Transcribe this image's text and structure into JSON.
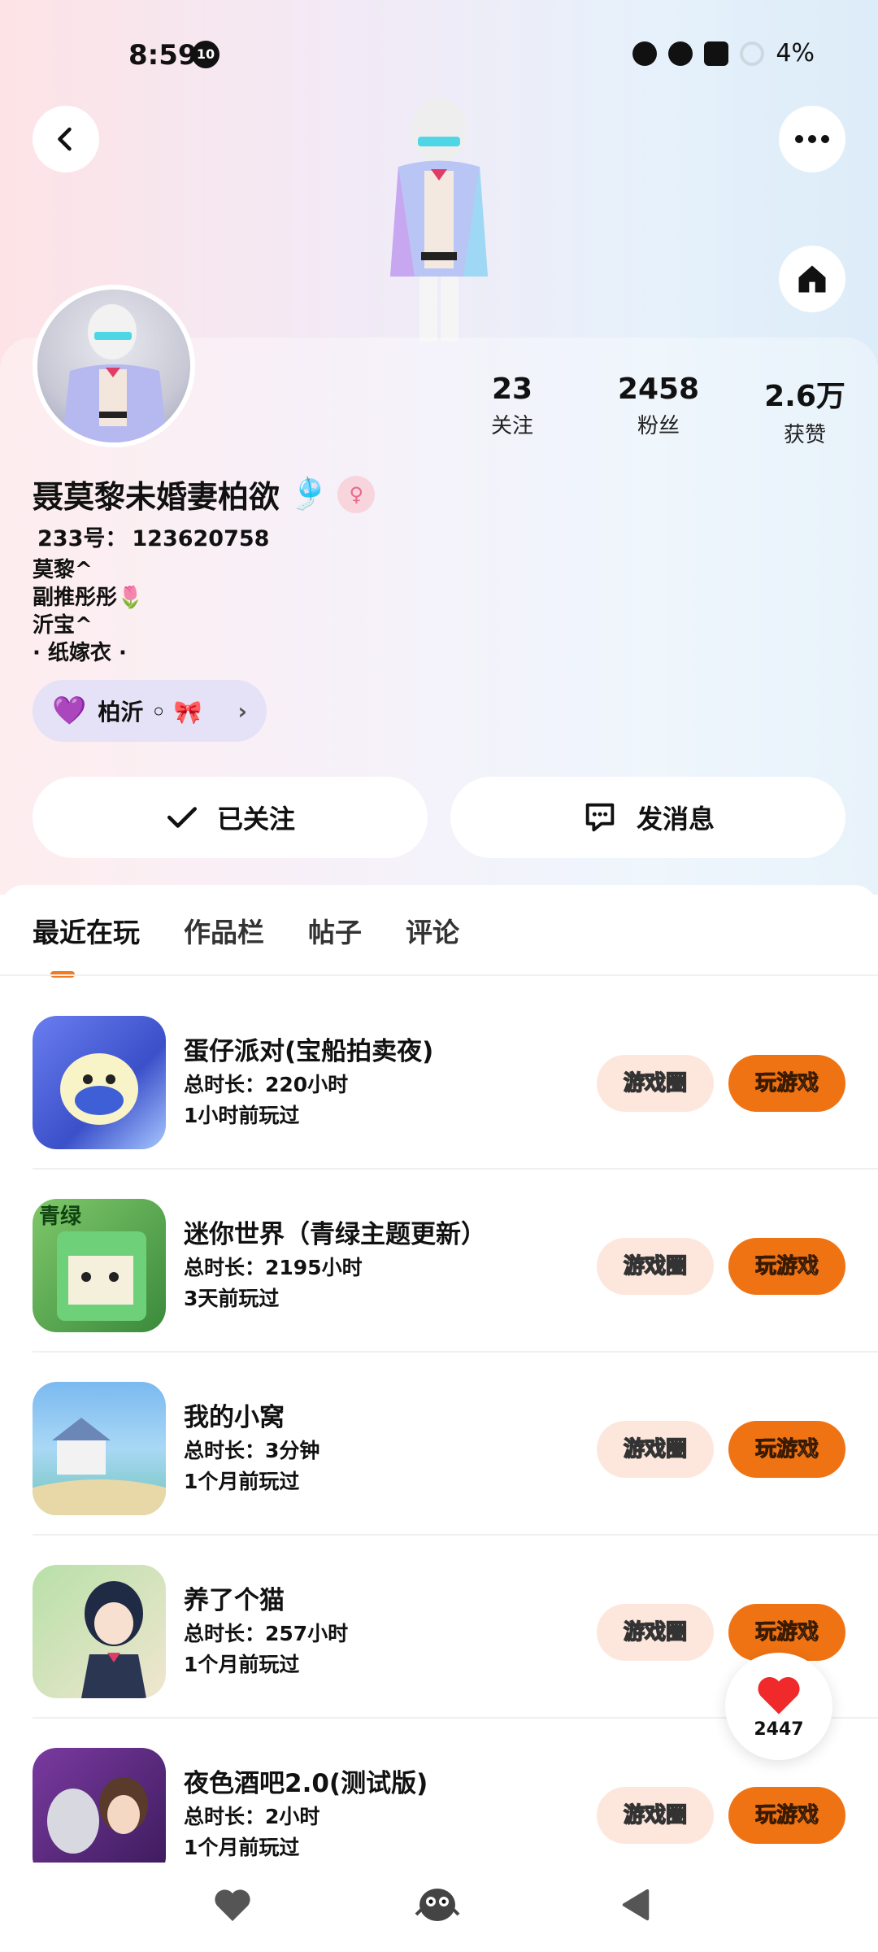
{
  "status": {
    "time": "8:59",
    "notification_badge": "10",
    "battery": "4%"
  },
  "header": {
    "back_icon": "chevron-left-icon",
    "more_icon": "ellipsis-icon",
    "home_icon": "home-icon"
  },
  "profile": {
    "stats": [
      {
        "value": "23",
        "label": "关注"
      },
      {
        "value": "2458",
        "label": "粉丝"
      },
      {
        "value": "2.6万",
        "label": "获赞"
      }
    ],
    "nickname": "聂莫黎未婚妻柏欲",
    "nickname_emoji": "🎐",
    "gender_symbol": "♀",
    "uid_label": "233号：",
    "uid_value": "123620758",
    "bio_lines": [
      "莫黎^",
      "副推彤彤🌷",
      "沂宝^",
      "· 纸嫁衣 ·"
    ],
    "tag_chip": {
      "label": "柏沂 ◦ 🎀",
      "heart": "💜"
    }
  },
  "actions": {
    "follow_label": "已关注",
    "message_label": "发消息"
  },
  "tabs": [
    "最近在玩",
    "作品栏",
    "帖子",
    "评论"
  ],
  "games": [
    {
      "title": "蛋仔派对(宝船拍卖夜)",
      "duration": "总时长：220小时",
      "last_played": "1小时前玩过"
    },
    {
      "title": "迷你世界（青绿主题更新）",
      "duration": "总时长：2195小时",
      "last_played": "3天前玩过",
      "icon_text": "青绿"
    },
    {
      "title": "我的小窝",
      "duration": "总时长：3分钟",
      "last_played": "1个月前玩过"
    },
    {
      "title": "养了个猫",
      "duration": "总时长：257小时",
      "last_played": "1个月前玩过"
    },
    {
      "title": "夜色酒吧2.0(测试版)",
      "duration": "总时长：2小时",
      "last_played": "1个月前玩过"
    }
  ],
  "game_buttons": {
    "circle": "游戏圈",
    "play": "玩游戏"
  },
  "like_float": {
    "count": "2447"
  },
  "colors": {
    "accent": "#f07313",
    "chip_bg": "#e5e1f6",
    "circle_btn_bg": "#fde7dd"
  }
}
